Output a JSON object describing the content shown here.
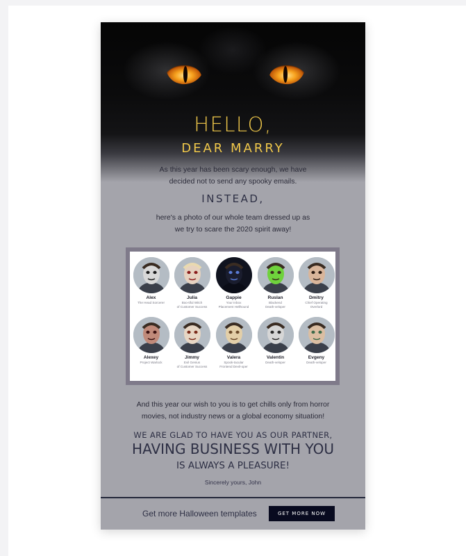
{
  "greeting": {
    "hello": "HELLO,",
    "dear": "DEAR MARRY"
  },
  "intro": {
    "line1": "As this year has been scary enough, we have",
    "line2": "decided not to send any spooky emails."
  },
  "instead": "INSTEAD,",
  "photo_caption": {
    "line1": "here's a photo of our whole team dressed up as",
    "line2": "we try to scare the 2020 spirit away!"
  },
  "team": [
    {
      "name": "Alex",
      "role": "The Head Sorcerer"
    },
    {
      "name": "Julia",
      "role": "Boo-tiful Witch\nof Customer Success"
    },
    {
      "name": "Gappie",
      "role": "Your Inbox\nPlacement Hellhound"
    },
    {
      "name": "Ruslan",
      "role": "Blackend\nDeath-veloper"
    },
    {
      "name": "Dmitry",
      "role": "Chief Operating\nOverlord"
    },
    {
      "name": "Alexey",
      "role": "Project Warlock"
    },
    {
      "name": "Jimmy",
      "role": "Evil Genius\nof Customer Success"
    },
    {
      "name": "Valera",
      "role": "Spook-tacular\nFrontend Devil-oper"
    },
    {
      "name": "Valentin",
      "role": "Death-veloper"
    },
    {
      "name": "Evgeny",
      "role": "Death-veloper"
    }
  ],
  "wish": {
    "line1": "And this year our wish to you is to get chills only from horror",
    "line2": "movies, not industry news or a global economy situation!"
  },
  "closing": {
    "glad": "WE ARE GLAD TO HAVE YOU AS OUR PARTNER,",
    "business": "HAVING BUSINESS WITH YOU",
    "always": "IS ALWAYS A PLEASURE!",
    "signature": "Sincerely yours, John"
  },
  "footer": {
    "text": "Get more Halloween templates",
    "button": "GET MORE NOW"
  },
  "colors": {
    "accent_gold": "#f0c84a",
    "email_bg": "#a4a4ab",
    "navy": "#080a1f",
    "eye_amber": "#f39a1c"
  }
}
